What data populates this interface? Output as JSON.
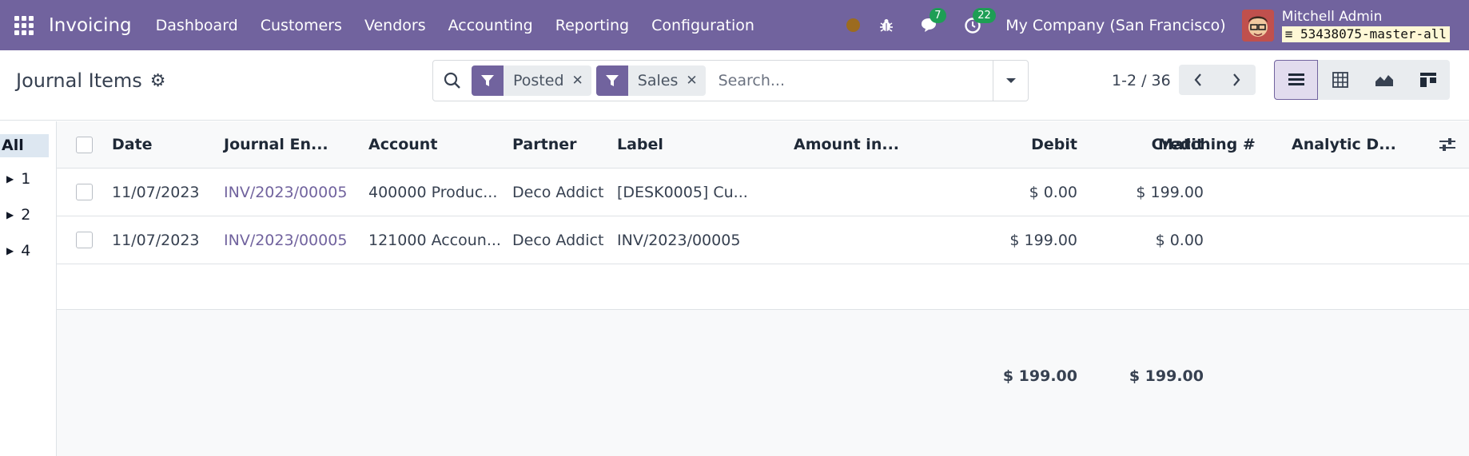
{
  "navbar": {
    "app_name": "Invoicing",
    "menu": [
      "Dashboard",
      "Customers",
      "Vendors",
      "Accounting",
      "Reporting",
      "Configuration"
    ],
    "messages_count": "7",
    "activities_count": "22",
    "company": "My Company (San Francisco)",
    "user_name": "Mitchell Admin",
    "database": "53438075-master-all"
  },
  "control": {
    "title": "Journal Items",
    "facets": [
      "Posted",
      "Sales"
    ],
    "search_placeholder": "Search...",
    "pager": "1-2 / 36"
  },
  "sidepanel": {
    "all_label": "All",
    "items": [
      "1",
      "2",
      "4"
    ]
  },
  "table": {
    "headers": {
      "date": "Date",
      "journal_entry": "Journal En...",
      "account": "Account",
      "partner": "Partner",
      "label": "Label",
      "amount_currency": "Amount in...",
      "debit": "Debit",
      "credit": "Credit",
      "matching": "Matching #",
      "analytic": "Analytic D..."
    },
    "rows": [
      {
        "date": "11/07/2023",
        "journal_entry": "INV/2023/00005",
        "account": "400000 Produc...",
        "partner": "Deco Addict",
        "label": "[DESK0005] Cu...",
        "debit": "$ 0.00",
        "credit": "$ 199.00"
      },
      {
        "date": "11/07/2023",
        "journal_entry": "INV/2023/00005",
        "account": "121000 Accoun...",
        "partner": "Deco Addict",
        "label": "INV/2023/00005",
        "debit": "$ 199.00",
        "credit": "$ 0.00"
      }
    ],
    "totals": {
      "debit": "$ 199.00",
      "credit": "$ 199.00"
    }
  },
  "colors": {
    "brand": "#71639e",
    "link": "#71639e",
    "badge": "#1e9e55"
  }
}
